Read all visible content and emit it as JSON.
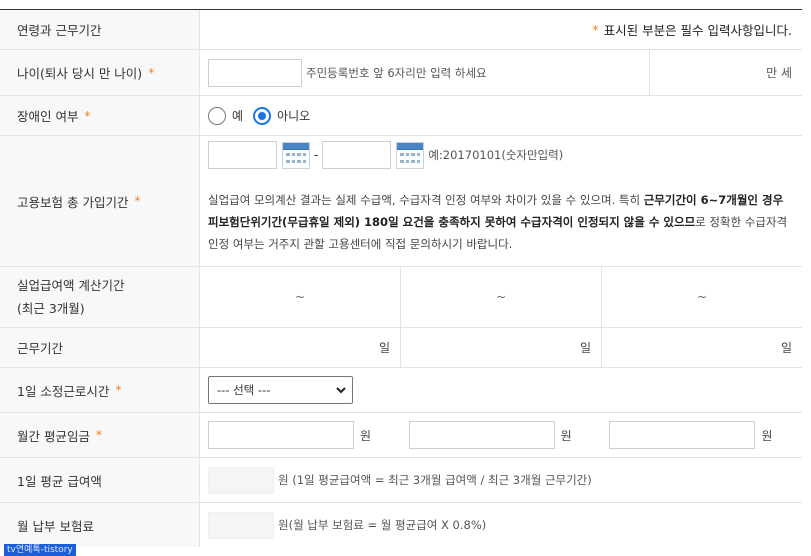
{
  "header": {
    "title": "연령과 근무기간",
    "note_star": "*",
    "note": "표시된 부분은 필수 입력사항입니다."
  },
  "required_mark": "*",
  "age": {
    "label": "나이(퇴사 당시 만 나이)",
    "input_value": "",
    "hint": "주민등록번호 앞 6자리만 입력 하세요",
    "unit": "만 세"
  },
  "disability": {
    "label": "장애인 여부",
    "options": [
      {
        "label": "예",
        "selected": false
      },
      {
        "label": "아니오",
        "selected": true
      }
    ]
  },
  "insurance_period": {
    "label": "고용보험 총 가입기간",
    "start_value": "",
    "dash": "-",
    "end_value": "",
    "example": "예:20170101(숫자만입력)",
    "notice": {
      "part1": "실업급여 모의계산 결과는 실제 수급액, 수급자격 인정 여부와 차이가 있을 수 있으며. 특히 ",
      "bold": "근무기간이 6~7개월인 경우 피보험단위기간(무급휴일 제외) 180일 요건을 충족하지 못하여 수급자격이 인정되지 않을 수 있으므",
      "part2": "로 정확한 수급자격 인정 여부는 거주지 관할 고용센터에 직접 문의하시기 바랍니다."
    }
  },
  "calc_period": {
    "label_line1": "실업급여액 계산기간",
    "label_line2": "(최근 3개월)",
    "cells": [
      "~",
      "~",
      "~"
    ]
  },
  "work_days": {
    "label": "근무기간",
    "cells": [
      "일",
      "일",
      "일"
    ]
  },
  "daily_hours": {
    "label": "1일 소정근로시간",
    "select_value": "--- 선택 ---"
  },
  "monthly_wage": {
    "label": "월간 평균임금",
    "units": [
      "원",
      "원",
      "원"
    ]
  },
  "daily_benefit": {
    "label": "1일 평균 급여액",
    "value": "",
    "desc": "원 (1일 평균급여액 = 최근 3개월 급여액 / 최근 3개월 근무기간)"
  },
  "monthly_premium": {
    "label": "월 납부 보험료",
    "value": "",
    "desc": "원(월 납부 보험료 = 월 평균급여 X 0.8%)"
  },
  "watermark": "tv연예톡-tistory",
  "colors": {
    "required": "#f07f24",
    "radio_selected": "#1a73e8",
    "label_bg": "#f8f8f8"
  }
}
